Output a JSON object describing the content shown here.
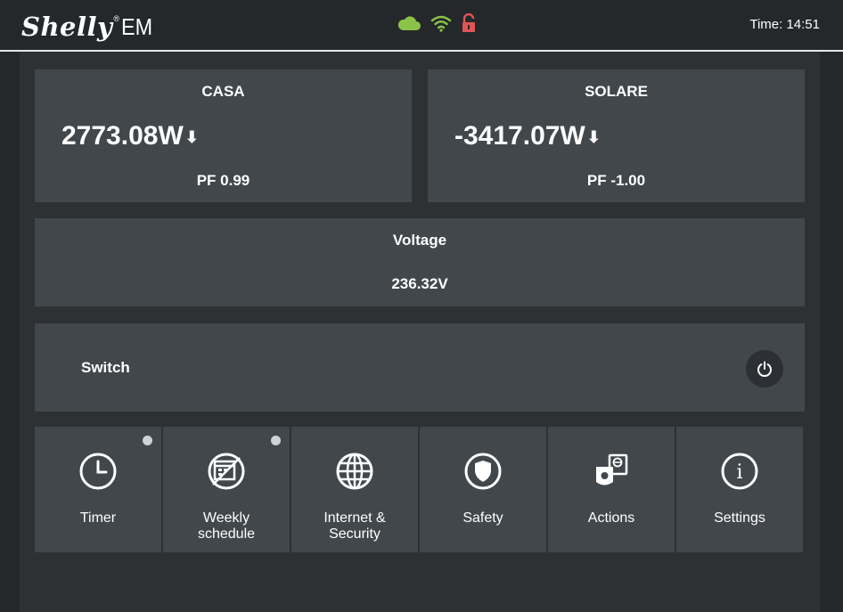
{
  "header": {
    "brand": "Shelly",
    "registered": "®",
    "model": "EM",
    "time_label": "Time: 14:51",
    "icons": [
      "cloud-icon",
      "wifi-icon",
      "unlocked-icon"
    ],
    "colors": {
      "cloud": "#8bc34a",
      "wifi": "#8bc34a",
      "lock": "#e05555"
    }
  },
  "channels": [
    {
      "name": "CASA",
      "power": "2773.08W",
      "pf": "PF 0.99"
    },
    {
      "name": "SOLARE",
      "power": "-3417.07W",
      "pf": "PF -1.00"
    }
  ],
  "voltage": {
    "title": "Voltage",
    "value": "236.32V"
  },
  "switch": {
    "label": "Switch"
  },
  "tiles": [
    {
      "label": "Timer",
      "icon": "clock-icon",
      "dot": true
    },
    {
      "label": "Weekly\nschedule",
      "icon": "calendar-icon",
      "dot": true
    },
    {
      "label": "Internet &\nSecurity",
      "icon": "globe-icon",
      "dot": false
    },
    {
      "label": "Safety",
      "icon": "shield-icon",
      "dot": false
    },
    {
      "label": "Actions",
      "icon": "actions-icon",
      "dot": false
    },
    {
      "label": "Settings",
      "icon": "info-icon",
      "dot": false
    }
  ]
}
